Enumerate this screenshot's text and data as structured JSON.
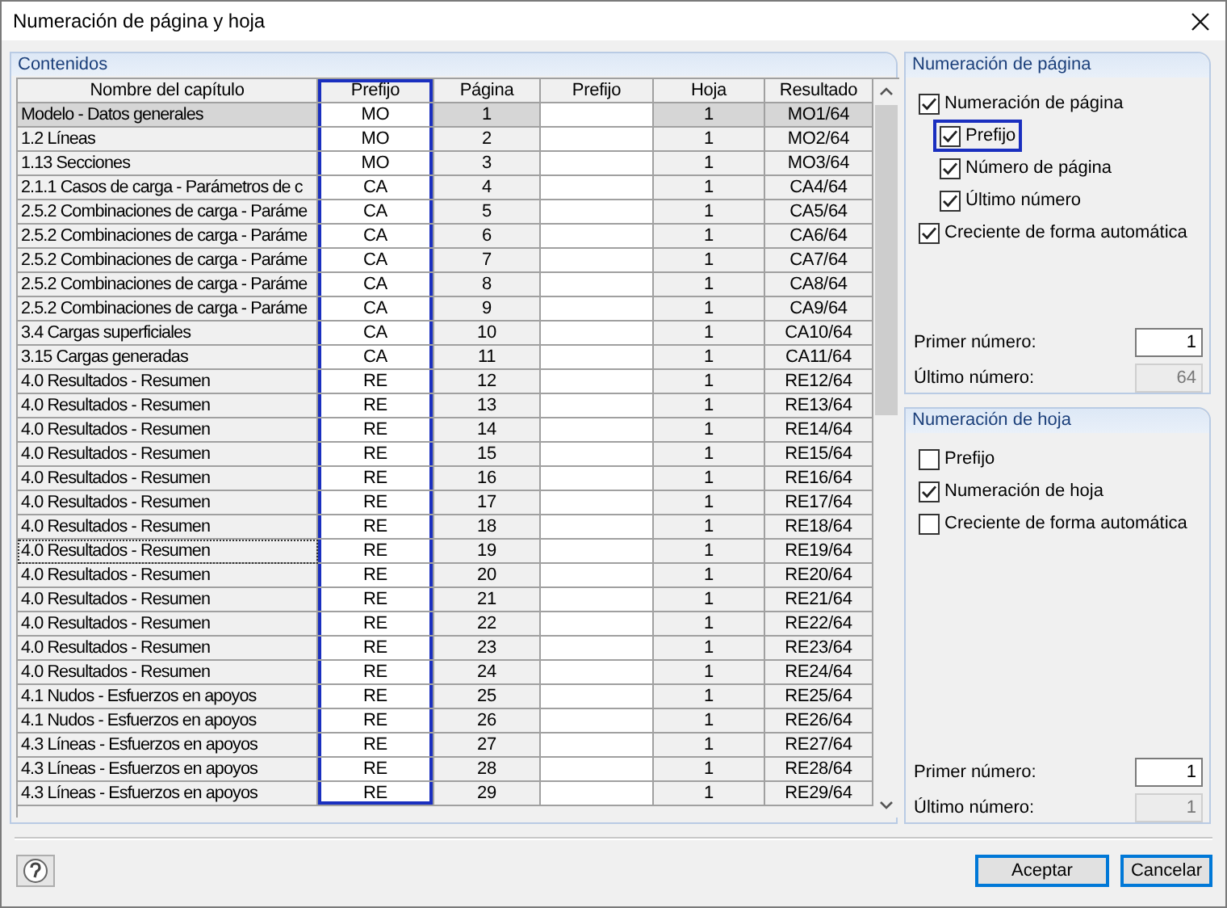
{
  "window": {
    "title": "Numeración de página y hoja"
  },
  "contents": {
    "title": "Contenidos",
    "columns": [
      {
        "label": "Nombre del capítulo",
        "kind": "chapter",
        "highlighted": false
      },
      {
        "label": "Prefijo",
        "kind": "prefix",
        "highlighted": true
      },
      {
        "label": "Página",
        "kind": "page",
        "highlighted": false
      },
      {
        "label": "Prefijo",
        "kind": "sheet_prefix",
        "highlighted": false
      },
      {
        "label": "Hoja",
        "kind": "sheet",
        "highlighted": false
      },
      {
        "label": "Resultado",
        "kind": "result",
        "highlighted": false
      }
    ],
    "rows": [
      {
        "chapter": "Modelo - Datos generales",
        "prefix": "MO",
        "page": "1",
        "sheet": "1",
        "result": "MO1/64",
        "selected": true,
        "focused": false
      },
      {
        "chapter": "1.2 Líneas",
        "prefix": "MO",
        "page": "2",
        "sheet": "1",
        "result": "MO2/64",
        "selected": false,
        "focused": false
      },
      {
        "chapter": "1.13 Secciones",
        "prefix": "MO",
        "page": "3",
        "sheet": "1",
        "result": "MO3/64",
        "selected": false,
        "focused": false
      },
      {
        "chapter": "2.1.1 Casos de carga - Parámetros de c",
        "prefix": "CA",
        "page": "4",
        "sheet": "1",
        "result": "CA4/64",
        "selected": false,
        "focused": false
      },
      {
        "chapter": "2.5.2 Combinaciones de carga - Paráme",
        "prefix": "CA",
        "page": "5",
        "sheet": "1",
        "result": "CA5/64",
        "selected": false,
        "focused": false
      },
      {
        "chapter": "2.5.2 Combinaciones de carga - Paráme",
        "prefix": "CA",
        "page": "6",
        "sheet": "1",
        "result": "CA6/64",
        "selected": false,
        "focused": false
      },
      {
        "chapter": "2.5.2 Combinaciones de carga - Paráme",
        "prefix": "CA",
        "page": "7",
        "sheet": "1",
        "result": "CA7/64",
        "selected": false,
        "focused": false
      },
      {
        "chapter": "2.5.2 Combinaciones de carga - Paráme",
        "prefix": "CA",
        "page": "8",
        "sheet": "1",
        "result": "CA8/64",
        "selected": false,
        "focused": false
      },
      {
        "chapter": "2.5.2 Combinaciones de carga - Paráme",
        "prefix": "CA",
        "page": "9",
        "sheet": "1",
        "result": "CA9/64",
        "selected": false,
        "focused": false
      },
      {
        "chapter": "3.4 Cargas superficiales",
        "prefix": "CA",
        "page": "10",
        "sheet": "1",
        "result": "CA10/64",
        "selected": false,
        "focused": false
      },
      {
        "chapter": "3.15 Cargas generadas",
        "prefix": "CA",
        "page": "11",
        "sheet": "1",
        "result": "CA11/64",
        "selected": false,
        "focused": false
      },
      {
        "chapter": "4.0 Resultados - Resumen",
        "prefix": "RE",
        "page": "12",
        "sheet": "1",
        "result": "RE12/64",
        "selected": false,
        "focused": false
      },
      {
        "chapter": "4.0 Resultados - Resumen",
        "prefix": "RE",
        "page": "13",
        "sheet": "1",
        "result": "RE13/64",
        "selected": false,
        "focused": false
      },
      {
        "chapter": "4.0 Resultados - Resumen",
        "prefix": "RE",
        "page": "14",
        "sheet": "1",
        "result": "RE14/64",
        "selected": false,
        "focused": false
      },
      {
        "chapter": "4.0 Resultados - Resumen",
        "prefix": "RE",
        "page": "15",
        "sheet": "1",
        "result": "RE15/64",
        "selected": false,
        "focused": false
      },
      {
        "chapter": "4.0 Resultados - Resumen",
        "prefix": "RE",
        "page": "16",
        "sheet": "1",
        "result": "RE16/64",
        "selected": false,
        "focused": false
      },
      {
        "chapter": "4.0 Resultados - Resumen",
        "prefix": "RE",
        "page": "17",
        "sheet": "1",
        "result": "RE17/64",
        "selected": false,
        "focused": false
      },
      {
        "chapter": "4.0 Resultados - Resumen",
        "prefix": "RE",
        "page": "18",
        "sheet": "1",
        "result": "RE18/64",
        "selected": false,
        "focused": false
      },
      {
        "chapter": "4.0 Resultados - Resumen",
        "prefix": "RE",
        "page": "19",
        "sheet": "1",
        "result": "RE19/64",
        "selected": false,
        "focused": true
      },
      {
        "chapter": "4.0 Resultados - Resumen",
        "prefix": "RE",
        "page": "20",
        "sheet": "1",
        "result": "RE20/64",
        "selected": false,
        "focused": false
      },
      {
        "chapter": "4.0 Resultados - Resumen",
        "prefix": "RE",
        "page": "21",
        "sheet": "1",
        "result": "RE21/64",
        "selected": false,
        "focused": false
      },
      {
        "chapter": "4.0 Resultados - Resumen",
        "prefix": "RE",
        "page": "22",
        "sheet": "1",
        "result": "RE22/64",
        "selected": false,
        "focused": false
      },
      {
        "chapter": "4.0 Resultados - Resumen",
        "prefix": "RE",
        "page": "23",
        "sheet": "1",
        "result": "RE23/64",
        "selected": false,
        "focused": false
      },
      {
        "chapter": "4.0 Resultados - Resumen",
        "prefix": "RE",
        "page": "24",
        "sheet": "1",
        "result": "RE24/64",
        "selected": false,
        "focused": false
      },
      {
        "chapter": "4.1 Nudos - Esfuerzos en apoyos",
        "prefix": "RE",
        "page": "25",
        "sheet": "1",
        "result": "RE25/64",
        "selected": false,
        "focused": false
      },
      {
        "chapter": "4.1 Nudos - Esfuerzos en apoyos",
        "prefix": "RE",
        "page": "26",
        "sheet": "1",
        "result": "RE26/64",
        "selected": false,
        "focused": false
      },
      {
        "chapter": "4.3 Líneas - Esfuerzos en apoyos",
        "prefix": "RE",
        "page": "27",
        "sheet": "1",
        "result": "RE27/64",
        "selected": false,
        "focused": false
      },
      {
        "chapter": "4.3 Líneas - Esfuerzos en apoyos",
        "prefix": "RE",
        "page": "28",
        "sheet": "1",
        "result": "RE28/64",
        "selected": false,
        "focused": false
      },
      {
        "chapter": "4.3 Líneas - Esfuerzos en apoyos",
        "prefix": "RE",
        "page": "29",
        "sheet": "1",
        "result": "RE29/64",
        "selected": false,
        "focused": false
      }
    ]
  },
  "page_numbering": {
    "title": "Numeración de página",
    "options": [
      {
        "label": "Numeración de página",
        "checked": true,
        "highlighted": false,
        "children": [
          {
            "label": "Prefijo",
            "checked": true,
            "highlighted": true
          },
          {
            "label": "Número de página",
            "checked": true,
            "highlighted": false
          },
          {
            "label": "Último número",
            "checked": true,
            "highlighted": false
          }
        ]
      },
      {
        "label": "Creciente de forma automática",
        "checked": true,
        "highlighted": false
      }
    ],
    "fields": [
      {
        "label": "Primer número:",
        "value": "1",
        "disabled": false
      },
      {
        "label": "Último número:",
        "value": "64",
        "disabled": true
      }
    ]
  },
  "sheet_numbering": {
    "title": "Numeración de hoja",
    "options": [
      {
        "label": "Prefijo",
        "checked": false,
        "highlighted": false
      },
      {
        "label": "Numeración de hoja",
        "checked": true,
        "highlighted": false
      },
      {
        "label": "Creciente de forma automática",
        "checked": false,
        "highlighted": false
      }
    ],
    "fields": [
      {
        "label": "Primer número:",
        "value": "1",
        "disabled": false
      },
      {
        "label": "Último número:",
        "value": "1",
        "disabled": true
      }
    ]
  },
  "buttons": [
    {
      "label": "Aceptar"
    },
    {
      "label": "Cancelar"
    }
  ]
}
